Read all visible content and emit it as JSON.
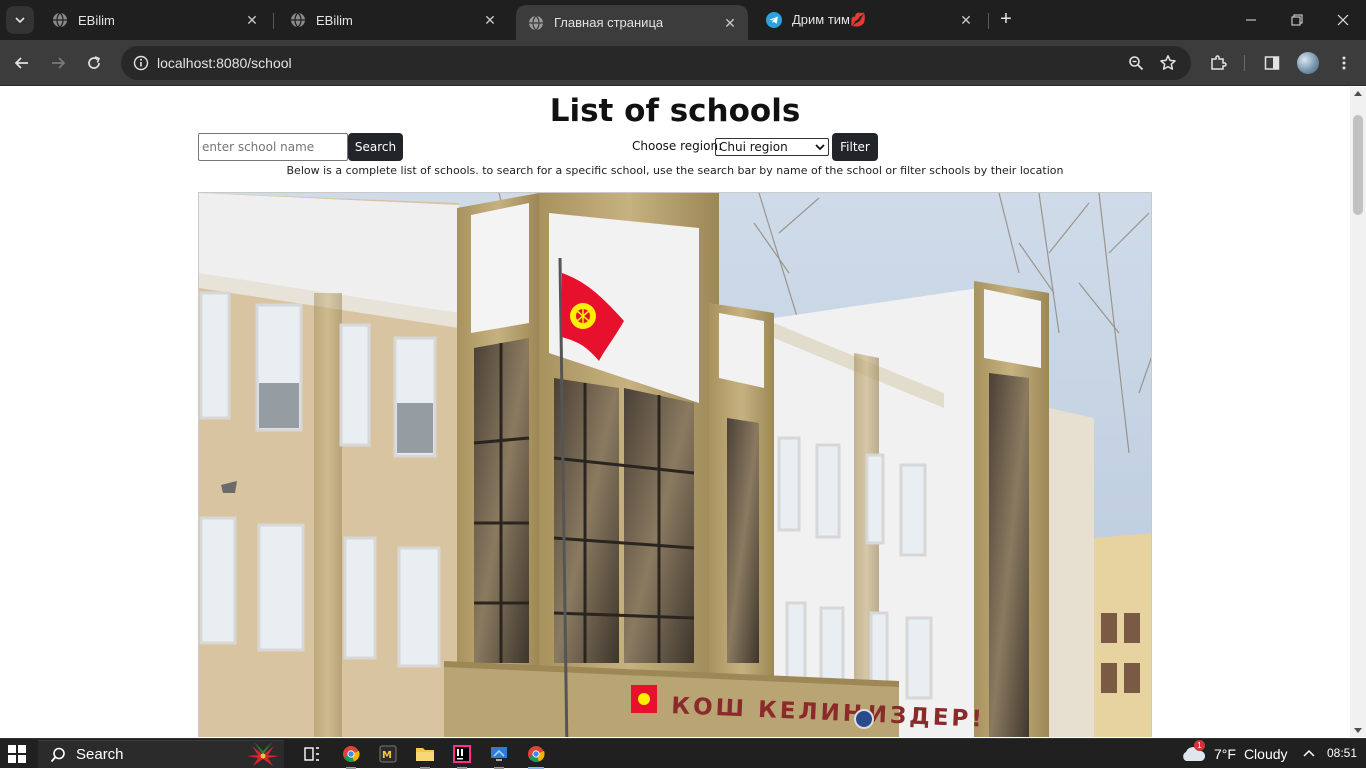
{
  "browser": {
    "tabs": [
      {
        "title": "EBilim",
        "favicon": "globe-icon",
        "active": false
      },
      {
        "title": "EBilim",
        "favicon": "globe-icon",
        "active": false
      },
      {
        "title": "Главная страница",
        "favicon": "globe-icon",
        "active": true
      },
      {
        "title": "Дрим тим💋",
        "favicon": "telegram-icon",
        "active": false
      }
    ],
    "url": "localhost:8080/school"
  },
  "page": {
    "title": "List of schools",
    "search": {
      "placeholder": "enter school name",
      "button_label": "Search"
    },
    "filter": {
      "label": "Choose region:",
      "selected_region": "Chui region",
      "button_label": "Filter"
    },
    "description": "Below is a complete list of schools. to search for a specific school, use the search bar by name of the school or filter schools by their location",
    "photo_sign_text": "КОШ КЕЛИҢИЗДЕР!"
  },
  "taskbar": {
    "search_label": "Search",
    "weather": {
      "temperature": "7°F",
      "condition": "Cloudy",
      "alert_count": "1"
    },
    "time": "08:51"
  },
  "colors": {
    "tab_strip": "#1f1f1f",
    "toolbar": "#3c3c3c",
    "dark_button": "#212529",
    "flag_red": "#e8112d",
    "flag_sun": "#ffef00",
    "facade_tan": "#b9a474"
  }
}
